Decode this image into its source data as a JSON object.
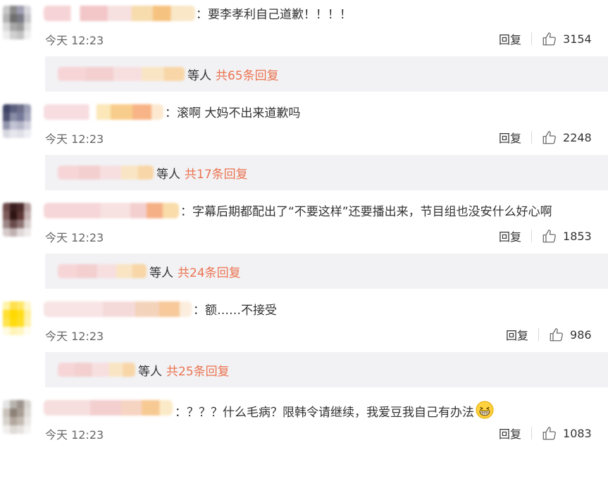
{
  "comments": [
    {
      "text": "：要李孝利自己道歉！！！！",
      "time": "今天 12:23",
      "reply_label": "回复",
      "likes": "3154",
      "sub": {
        "suffix": "等人",
        "count": "共65条回复"
      },
      "avatar_colors": [
        "#c7c7c7",
        "#8a8a8a",
        "#a09fb3",
        "#d8d6dd",
        "#b3b3b3",
        "#6f6f6f",
        "#7a7a85",
        "#c9c8cc",
        "#d9d9d9",
        "#a8a8a8",
        "#9b9b9b",
        "#e2e2e2",
        "#eeeeee",
        "#d0d0d0",
        "#c3c3c3",
        "#f0f0f0"
      ]
    },
    {
      "text": "：滚啊 大妈不出来道歉吗",
      "time": "今天 12:23",
      "reply_label": "回复",
      "likes": "2248",
      "sub": {
        "suffix": "等人",
        "count": "共17条回复"
      },
      "avatar_colors": [
        "#3f4467",
        "#5a5f7e",
        "#6d6f8b",
        "#9da0b6",
        "#4f5373",
        "#8a8da6",
        "#77799a",
        "#a9abc0",
        "#9395ad",
        "#c2c3d3",
        "#b5b6c8",
        "#d2d3df",
        "#d8d8e2",
        "#e6e6ee",
        "#e0e0e8",
        "#eeeeF4"
      ]
    },
    {
      "text": "：字幕后期都配出了“不要这样”还要播出来，节目组也没安什么好心啊",
      "time": "今天 12:23",
      "reply_label": "回复",
      "likes": "1853",
      "sub": {
        "suffix": "等人",
        "count": "共24条回复"
      },
      "avatar_colors": [
        "#6e4a4a",
        "#3b1f1f",
        "#4a2a2a",
        "#b79f9f",
        "#7d5b5b",
        "#2e1414",
        "#5c3636",
        "#c7b3b3",
        "#9b8585",
        "#6a4b4b",
        "#8e7373",
        "#d9cfcf",
        "#d5caca",
        "#c0b1b1",
        "#e0d8d8",
        "#efeaea"
      ]
    },
    {
      "text": "：额……不接受",
      "time": "今天 12:23",
      "reply_label": "回复",
      "likes": "986",
      "sub": {
        "suffix": "等人",
        "count": "共25条回复"
      },
      "avatar_colors": [
        "#fff3a8",
        "#ffe04d",
        "#ffe666",
        "#fff7c9",
        "#ffe033",
        "#ffd900",
        "#ffdd1a",
        "#fff1a0",
        "#ffe44d",
        "#ffdb0d",
        "#ffde26",
        "#fff2ad",
        "#fffbe0",
        "#fff4b8",
        "#fff6c4",
        "#fffdf0"
      ]
    },
    {
      "text": "：？？？什么毛病？限韩令请继续，我爱豆我自己有办法",
      "time": "今天 12:23",
      "reply_label": "回复",
      "likes": "1083",
      "avatar_colors": [
        "#e5e5e5",
        "#b8b3ad",
        "#9d948d",
        "#d8d4d0",
        "#c9c2bb",
        "#8d8178",
        "#a79d94",
        "#e0dcd8",
        "#d7d2cd",
        "#b1a79e",
        "#c3bbb3",
        "#ebe8e5",
        "#f2f0ee",
        "#dedad6",
        "#e6e3e0",
        "#f6f5f4"
      ]
    }
  ],
  "colors": {
    "accent": "#eb7350",
    "reply_bg": "#f2f2f5",
    "text": "#333333",
    "meta": "#666666"
  },
  "icons": {
    "like": "thumbs-up-icon",
    "emoji": "grin-emoji-icon"
  }
}
